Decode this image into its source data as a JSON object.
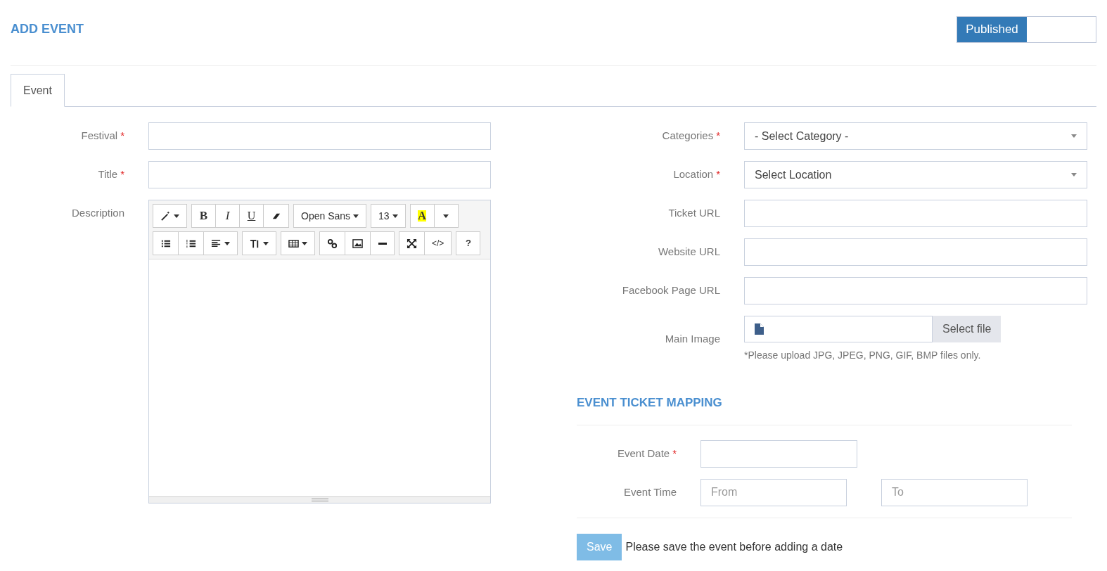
{
  "page_title": "ADD EVENT",
  "publish_toggle": {
    "label": "Published",
    "on": true
  },
  "tabs": [
    {
      "label": "Event",
      "selected": true
    }
  ],
  "left_fields": [
    {
      "label": "Festival",
      "required_mark": "*",
      "kind": "text"
    },
    {
      "label": "Title",
      "required_mark": "*",
      "kind": "text"
    },
    {
      "label": "Description",
      "kind": "editor"
    }
  ],
  "editor_toolbar": [
    [
      {
        "kind": "wand",
        "caret": true
      }
    ],
    [
      {
        "kind": "bold",
        "label": "B"
      },
      {
        "kind": "italic",
        "label": "I"
      },
      {
        "kind": "underline",
        "label": "U"
      },
      {
        "kind": "eraser"
      }
    ],
    [
      {
        "kind": "font",
        "label": "Open Sans",
        "caret": true
      }
    ],
    [
      {
        "kind": "size",
        "label": "13",
        "caret": true
      }
    ],
    [
      {
        "kind": "color",
        "label": "A"
      },
      {
        "kind": "caret"
      }
    ]
  ],
  "editor_toolbar_row2": [
    [
      {
        "kind": "ul"
      },
      {
        "kind": "ol"
      },
      {
        "kind": "align",
        "caret": true
      }
    ],
    [
      {
        "kind": "height",
        "caret": true
      }
    ],
    [
      {
        "kind": "table",
        "caret": true
      }
    ],
    [
      {
        "kind": "link"
      },
      {
        "kind": "picture"
      },
      {
        "kind": "hr"
      }
    ],
    [
      {
        "kind": "fullscreen"
      },
      {
        "kind": "code",
        "label": "</>"
      }
    ],
    [
      {
        "kind": "help",
        "label": "?"
      }
    ]
  ],
  "right_fields": [
    {
      "label": "Categories",
      "required_mark": "*",
      "kind": "select",
      "value": "- Select Category -"
    },
    {
      "label": "Location",
      "required_mark": "*",
      "kind": "select",
      "value": "Select Location"
    },
    {
      "label": "Ticket URL",
      "kind": "text"
    },
    {
      "label": "Website URL",
      "kind": "text"
    },
    {
      "label": "Facebook Page URL",
      "kind": "text"
    },
    {
      "label": "Main Image",
      "kind": "file",
      "button": "Select file",
      "hint": "*Please upload JPG, JPEG, PNG, GIF, BMP files only."
    }
  ],
  "ticket_mapping": {
    "title": "EVENT TICKET MAPPING",
    "event_date": {
      "label": "Event Date",
      "required_mark": "*"
    },
    "event_time": {
      "label": "Event Time",
      "from_placeholder": "From",
      "to_placeholder": "To"
    }
  },
  "save_button": {
    "label": "Save",
    "disabled": true
  },
  "save_note": "Please save the event before adding a date"
}
